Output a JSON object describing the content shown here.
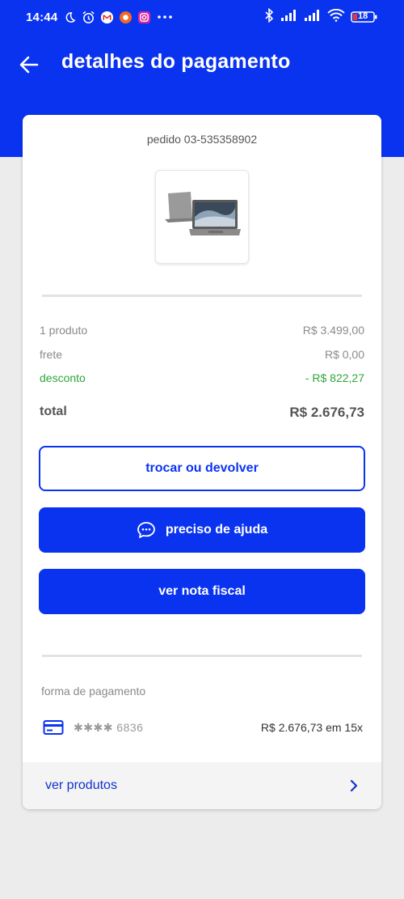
{
  "status_bar": {
    "time": "14:44",
    "battery": "18"
  },
  "header": {
    "title": "detalhes do pagamento"
  },
  "order": {
    "id_text": "pedido 03-535358902"
  },
  "summary": {
    "products_label": "1 produto",
    "products_value": "R$ 3.499,00",
    "shipping_label": "frete",
    "shipping_value": "R$ 0,00",
    "discount_label": "desconto",
    "discount_value": "- R$ 822,27",
    "total_label": "total",
    "total_value": "R$ 2.676,73"
  },
  "actions": {
    "exchange_label": "trocar ou devolver",
    "help_label": "preciso de ajuda",
    "invoice_label": "ver nota fiscal"
  },
  "payment": {
    "section_label": "forma de pagamento",
    "card_masked": "✱✱✱✱ 6836",
    "amount_text": "R$ 2.676,73 em 15x"
  },
  "footer": {
    "link_label": "ver produtos"
  },
  "colors": {
    "brand_blue": "#0a33f0",
    "discount_green": "#2ea63a",
    "link_blue": "#1133cc"
  },
  "icons": {
    "back": "arrow-left-icon",
    "chat": "chat-bubble-icon",
    "card": "credit-card-icon",
    "chevron": "chevron-right-icon"
  }
}
